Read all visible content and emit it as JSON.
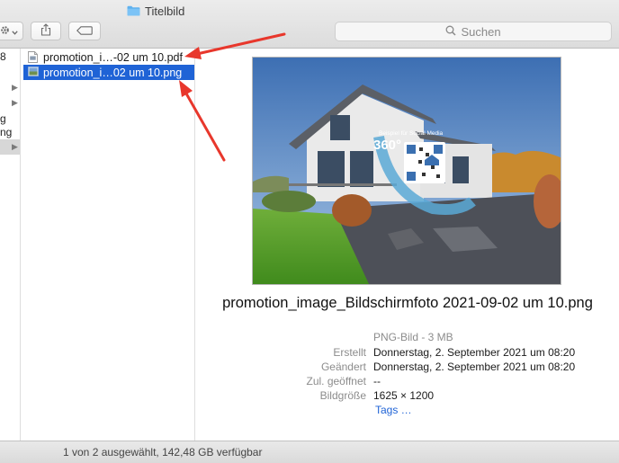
{
  "window": {
    "title": "Titelbild"
  },
  "toolbar": {
    "action_icon": "gear-icon",
    "share_icon": "share-icon",
    "tag_icon": "tag-icon",
    "search_placeholder": "Suchen"
  },
  "left_column": {
    "fragments": [
      "8",
      "g",
      "ng"
    ],
    "rows_with_arrows": 4
  },
  "files": [
    {
      "name": "promotion_i…-02 um 10.pdf",
      "icon": "pdf-file-icon",
      "selected": false
    },
    {
      "name": "promotion_i…02 um 10.png",
      "icon": "image-file-icon",
      "selected": true
    }
  ],
  "preview": {
    "image_overlay_text": "Beispiel für Social Media",
    "image_overlay_badge": "360°",
    "filename": "promotion_image_Bildschirmfoto 2021-09-02 um 10.png",
    "kind": "PNG-Bild - 3 MB",
    "meta": [
      {
        "label": "Erstellt",
        "value": "Donnerstag, 2. September 2021 um 08:20"
      },
      {
        "label": "Geändert",
        "value": "Donnerstag, 2. September 2021 um 08:20"
      },
      {
        "label": "Zul. geöffnet",
        "value": "--"
      },
      {
        "label": "Bildgröße",
        "value": "1625 × 1200"
      }
    ],
    "tags_link": "Tags …"
  },
  "status": {
    "text": "1 von 2 ausgewählt, 142,48 GB verfügbar"
  },
  "colors": {
    "selection": "#1f63d6",
    "annotation_arrow": "#e8372c",
    "link": "#1f63d6"
  }
}
